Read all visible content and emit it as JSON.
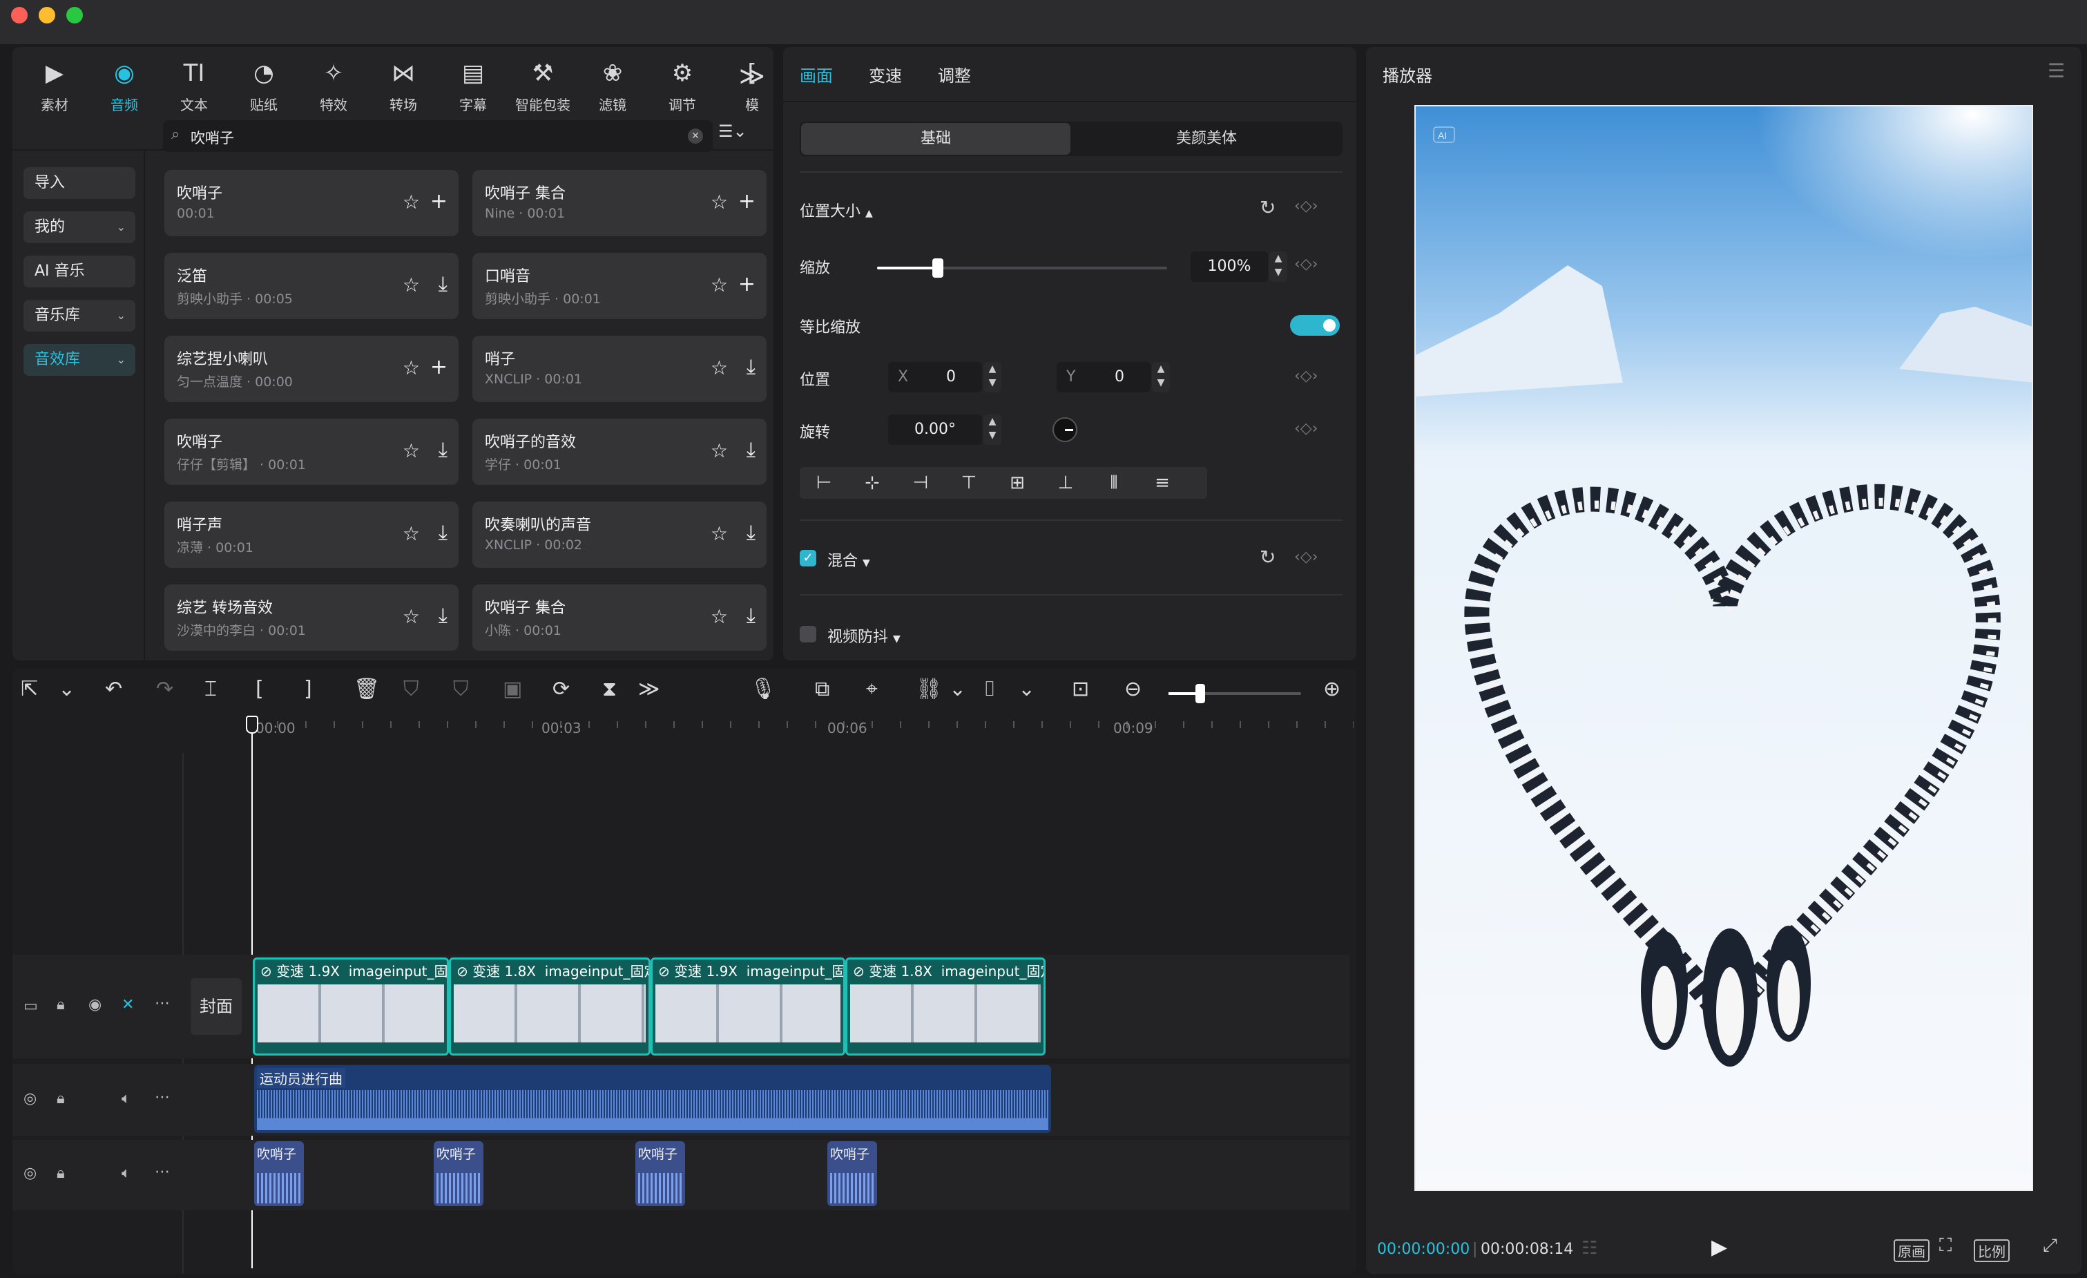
{
  "window": {
    "traffic_colors": [
      "#fe5f57",
      "#febc2e",
      "#28c840"
    ]
  },
  "toolbar": {
    "items": [
      {
        "label": "素材",
        "icon": "media-icon"
      },
      {
        "label": "音频",
        "icon": "audio-icon"
      },
      {
        "label": "文本",
        "icon": "text-icon"
      },
      {
        "label": "贴纸",
        "icon": "sticker-icon"
      },
      {
        "label": "特效",
        "icon": "effects-icon"
      },
      {
        "label": "转场",
        "icon": "transition-icon"
      },
      {
        "label": "字幕",
        "icon": "caption-icon"
      },
      {
        "label": "智能包装",
        "icon": "smart-pack-icon"
      },
      {
        "label": "滤镜",
        "icon": "filter-icon"
      },
      {
        "label": "调节",
        "icon": "adjust-icon"
      },
      {
        "label": "模",
        "icon": "template-icon"
      }
    ],
    "more": "≫",
    "active_color": "#27c2e0"
  },
  "sidebar": {
    "items": [
      {
        "label": "导入",
        "chev": ""
      },
      {
        "label": "我的",
        "chev": "⌄"
      },
      {
        "label": "AI 音乐",
        "chev": ""
      },
      {
        "label": "音乐库",
        "chev": "⌄"
      },
      {
        "label": "音效库",
        "chev": "⌄"
      }
    ]
  },
  "search": {
    "value": "吹哨子",
    "filter": "⚲"
  },
  "results": [
    {
      "title": "吹哨子",
      "sub": "00:01",
      "action": "add"
    },
    {
      "title": "吹哨子 集合",
      "sub": "Nine · 00:01",
      "action": "add"
    },
    {
      "title": "泛笛",
      "sub": "剪映小助手 · 00:05",
      "action": "download"
    },
    {
      "title": "口哨音",
      "sub": "剪映小助手 · 00:01",
      "action": "add"
    },
    {
      "title": "综艺捏小喇叭",
      "sub": "匀一点温度 · 00:00",
      "action": "add"
    },
    {
      "title": "哨子",
      "sub": "XNCLIP · 00:01",
      "action": "download"
    },
    {
      "title": "吹哨子",
      "sub": "仔仔【剪辑】 · 00:01",
      "action": "download"
    },
    {
      "title": "吹哨子的音效",
      "sub": "学仔 · 00:01",
      "action": "download"
    },
    {
      "title": "哨子声",
      "sub": "凉薄 · 00:01",
      "action": "download"
    },
    {
      "title": "吹奏喇叭的声音",
      "sub": "XNCLIP · 00:02",
      "action": "download"
    },
    {
      "title": "综艺 转场音效",
      "sub": "沙漠中的李白 · 00:01",
      "action": "download"
    },
    {
      "title": "吹哨子 集合",
      "sub": "小陈 · 00:01",
      "action": "download"
    }
  ],
  "inspector": {
    "tabs": [
      "画面",
      "变速",
      "调整"
    ],
    "subtabs": [
      "基础",
      "美颜美体"
    ],
    "section_pos": "位置大小",
    "scale_label": "缩放",
    "scale_value": "100%",
    "scale_fraction": 0.21,
    "lock_ratio_label": "等比缩放",
    "lock_ratio_on": true,
    "position_label": "位置",
    "x_label": "X",
    "x_value": "0",
    "y_label": "Y",
    "y_value": "0",
    "rotation_label": "旋转",
    "rotation_value": "0.00°",
    "blend_label": "混合",
    "blend_checked": true,
    "stabilize_label": "视频防抖",
    "stabilize_checked": false
  },
  "timeline": {
    "ticks": [
      "00:00",
      "00:03",
      "00:06",
      "00:09"
    ],
    "cover_label": "封面",
    "clips": [
      {
        "speed": "变速 1.9X",
        "name": "imageinput_固"
      },
      {
        "speed": "变速 1.8X",
        "name": "imageinput_固定"
      },
      {
        "speed": "变速 1.9X",
        "name": "imageinput_固"
      },
      {
        "speed": "变速 1.8X",
        "name": "imageinput_固定"
      }
    ],
    "music_label": "运动员进行曲",
    "sfx_labels": [
      "吹哨子",
      "吹哨子",
      "吹哨子",
      "吹哨子"
    ],
    "zoom_fraction": 0.24
  },
  "player": {
    "title": "播放器",
    "current_time": "00:00:00:00",
    "total_time": "00:00:08:14",
    "btn_original": "原画",
    "btn_ratio": "比例",
    "ai_badge": "AI",
    "time_color": "#27c2e0"
  }
}
